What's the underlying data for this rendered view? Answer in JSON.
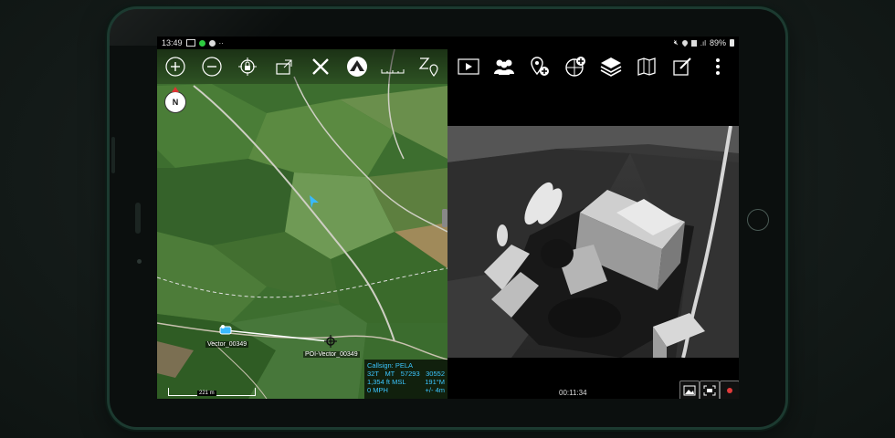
{
  "status_bar": {
    "time": "13:49",
    "battery": "89%",
    "left_icons": [
      "gallery-icon",
      "status-dot-icon",
      "settings-icon",
      "more-dots"
    ],
    "right_icons": [
      "mute-icon",
      "location-icon",
      "alarm-icon",
      "signal-icon",
      "battery-icon"
    ]
  },
  "map_toolbar": {
    "icons": [
      "zoom-in-icon",
      "zoom-out-icon",
      "lock-location-icon",
      "export-icon",
      "close-x-icon",
      "tak-logo-icon",
      "ruler-icon",
      "zoom-to-location-icon"
    ]
  },
  "video_toolbar": {
    "icons": [
      "video-play-icon",
      "contacts-icon",
      "add-point-icon",
      "add-overlay-icon",
      "layers-icon",
      "map-icon",
      "edit-icon",
      "more-vert-icon"
    ]
  },
  "map": {
    "compass_label": "N",
    "marker_self_label": "Vector_00349",
    "marker_target_label": "POI-Vector_00349",
    "scale_label": "221 m",
    "info": {
      "callsign": "Callsign: PELA",
      "grid": "32T",
      "grid_zone": "MT",
      "easting": "57293",
      "northing": "30552",
      "altitude": "1,354 ft MSL",
      "heading": "191°M",
      "speed": "0 MPH",
      "accuracy": "+/- 4m"
    }
  },
  "video": {
    "timer": "00:11:34",
    "buttons": [
      "snapshot-icon",
      "capture-frame-icon",
      "record-icon"
    ]
  },
  "colors": {
    "info_text": "#3cc6ff",
    "map_green": "#3a6a2c",
    "record_red": "#e23b3b"
  }
}
